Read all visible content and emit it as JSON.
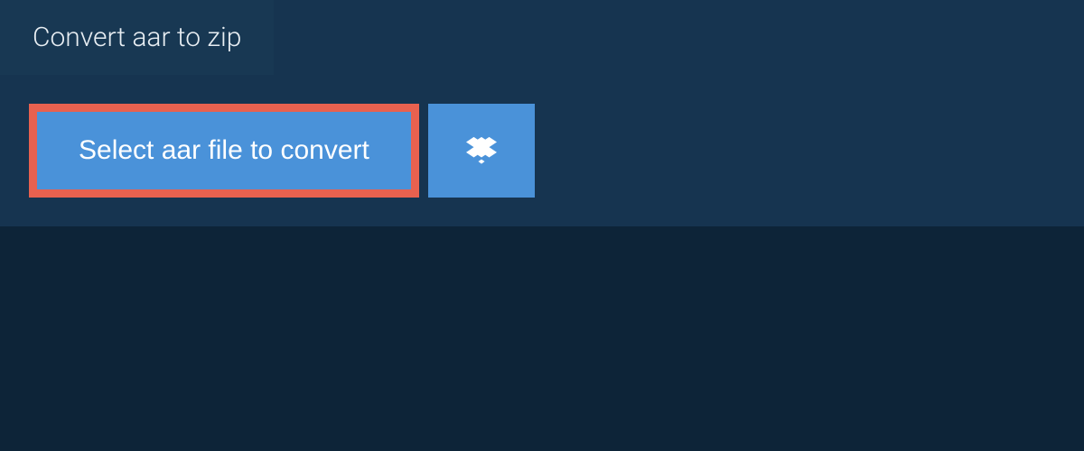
{
  "tab": {
    "title": "Convert aar to zip"
  },
  "buttons": {
    "select_label": "Select aar file to convert"
  },
  "colors": {
    "background": "#0d2438",
    "panel": "#163450",
    "tab": "#183853",
    "highlight_border": "#e8614f",
    "button": "#4a92d9",
    "text_light": "#e8eef3",
    "text_white": "#ffffff"
  }
}
